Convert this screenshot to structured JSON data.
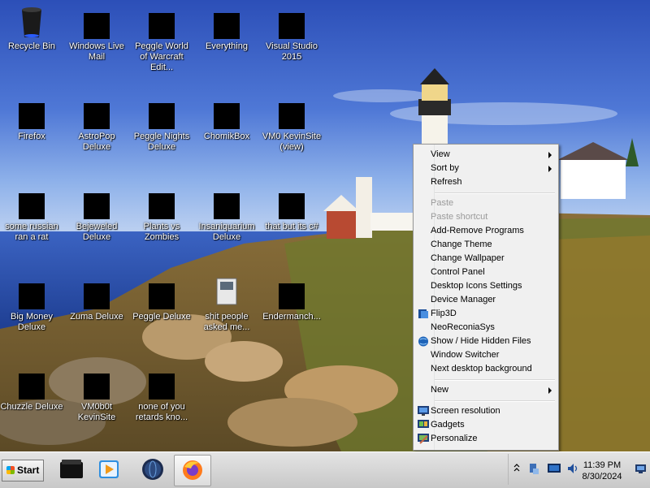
{
  "desktop": {
    "icons": [
      {
        "label": "Recycle Bin",
        "icon": "recycle-bin-icon"
      },
      {
        "label": "Windows Live Mail",
        "icon": "mail-icon"
      },
      {
        "label": "Peggle World of Warcraft Edit...",
        "icon": "peggle-icon"
      },
      {
        "label": "Everything",
        "icon": "search-app-icon"
      },
      {
        "label": "Visual Studio 2015",
        "icon": "visual-studio-icon"
      },
      {
        "label": "Firefox",
        "icon": "firefox-icon"
      },
      {
        "label": "AstroPop Deluxe",
        "icon": "game-icon"
      },
      {
        "label": "Peggle Nights Deluxe",
        "icon": "peggle-icon"
      },
      {
        "label": "ChomikBox",
        "icon": "chomikbox-icon"
      },
      {
        "label": "VM0 KevinSite (view)",
        "icon": "vm-icon"
      },
      {
        "label": "some russian ran a rat",
        "icon": "file-icon"
      },
      {
        "label": "Bejeweled Deluxe",
        "icon": "gem-icon"
      },
      {
        "label": "Plants vs Zombies",
        "icon": "plant-icon"
      },
      {
        "label": "Insaniquarium Deluxe",
        "icon": "fish-icon"
      },
      {
        "label": "that but its c#",
        "icon": "file-icon"
      },
      {
        "label": "Big Money Deluxe",
        "icon": "money-icon"
      },
      {
        "label": "Zuma Deluxe",
        "icon": "zuma-icon"
      },
      {
        "label": "Peggle Deluxe",
        "icon": "peggle-icon"
      },
      {
        "label": "shit people asked me...",
        "icon": "folder-icon"
      },
      {
        "label": "Endermanch...",
        "icon": "terminal-icon"
      },
      {
        "label": "Chuzzle Deluxe",
        "icon": "chuzzle-icon"
      },
      {
        "label": "VM0b0t KevinSite",
        "icon": "vm-icon"
      },
      {
        "label": "none of you retards kno...",
        "icon": "peggle-icon"
      }
    ]
  },
  "context_menu": {
    "items": [
      {
        "label": "View",
        "submenu": true,
        "disabled": false
      },
      {
        "label": "Sort by",
        "submenu": true,
        "disabled": false
      },
      {
        "label": "Refresh",
        "submenu": false,
        "disabled": false
      },
      {
        "separator": true
      },
      {
        "label": "Paste",
        "submenu": false,
        "disabled": true
      },
      {
        "label": "Paste shortcut",
        "submenu": false,
        "disabled": true
      },
      {
        "label": "Add-Remove Programs",
        "submenu": false,
        "disabled": false
      },
      {
        "label": "Change Theme",
        "submenu": false,
        "disabled": false
      },
      {
        "label": "Change Wallpaper",
        "submenu": false,
        "disabled": false
      },
      {
        "label": "Control Panel",
        "submenu": false,
        "disabled": false
      },
      {
        "label": "Desktop Icons Settings",
        "submenu": false,
        "disabled": false
      },
      {
        "label": "Device Manager",
        "submenu": false,
        "disabled": false
      },
      {
        "label": "Flip3D",
        "submenu": false,
        "disabled": false,
        "icon": "flip3d-icon"
      },
      {
        "label": "NeoReconiaSys",
        "submenu": false,
        "disabled": false
      },
      {
        "label": "Show / Hide Hidden Files",
        "submenu": false,
        "disabled": false,
        "icon": "globe-icon"
      },
      {
        "label": "Window Switcher",
        "submenu": false,
        "disabled": false
      },
      {
        "label": "Next desktop background",
        "submenu": false,
        "disabled": false
      },
      {
        "separator": true
      },
      {
        "label": "New",
        "submenu": true,
        "disabled": false
      },
      {
        "separator": true
      },
      {
        "label": "Screen resolution",
        "submenu": false,
        "disabled": false,
        "icon": "monitor-icon"
      },
      {
        "label": "Gadgets",
        "submenu": false,
        "disabled": false,
        "icon": "gadgets-icon"
      },
      {
        "label": "Personalize",
        "submenu": false,
        "disabled": false,
        "icon": "personalize-icon"
      }
    ]
  },
  "taskbar": {
    "start_label": "Start",
    "pinned": [
      {
        "name": "file-explorer-icon"
      },
      {
        "name": "media-player-icon"
      },
      {
        "name": "globe-browser-icon"
      },
      {
        "name": "firefox-icon"
      }
    ],
    "tray": {
      "time": "11:39 PM",
      "date": "8/30/2024",
      "icons": [
        "show-hidden-icons-chevron",
        "network-icon",
        "monitor-icon",
        "volume-icon",
        "action-center-icon"
      ]
    }
  }
}
